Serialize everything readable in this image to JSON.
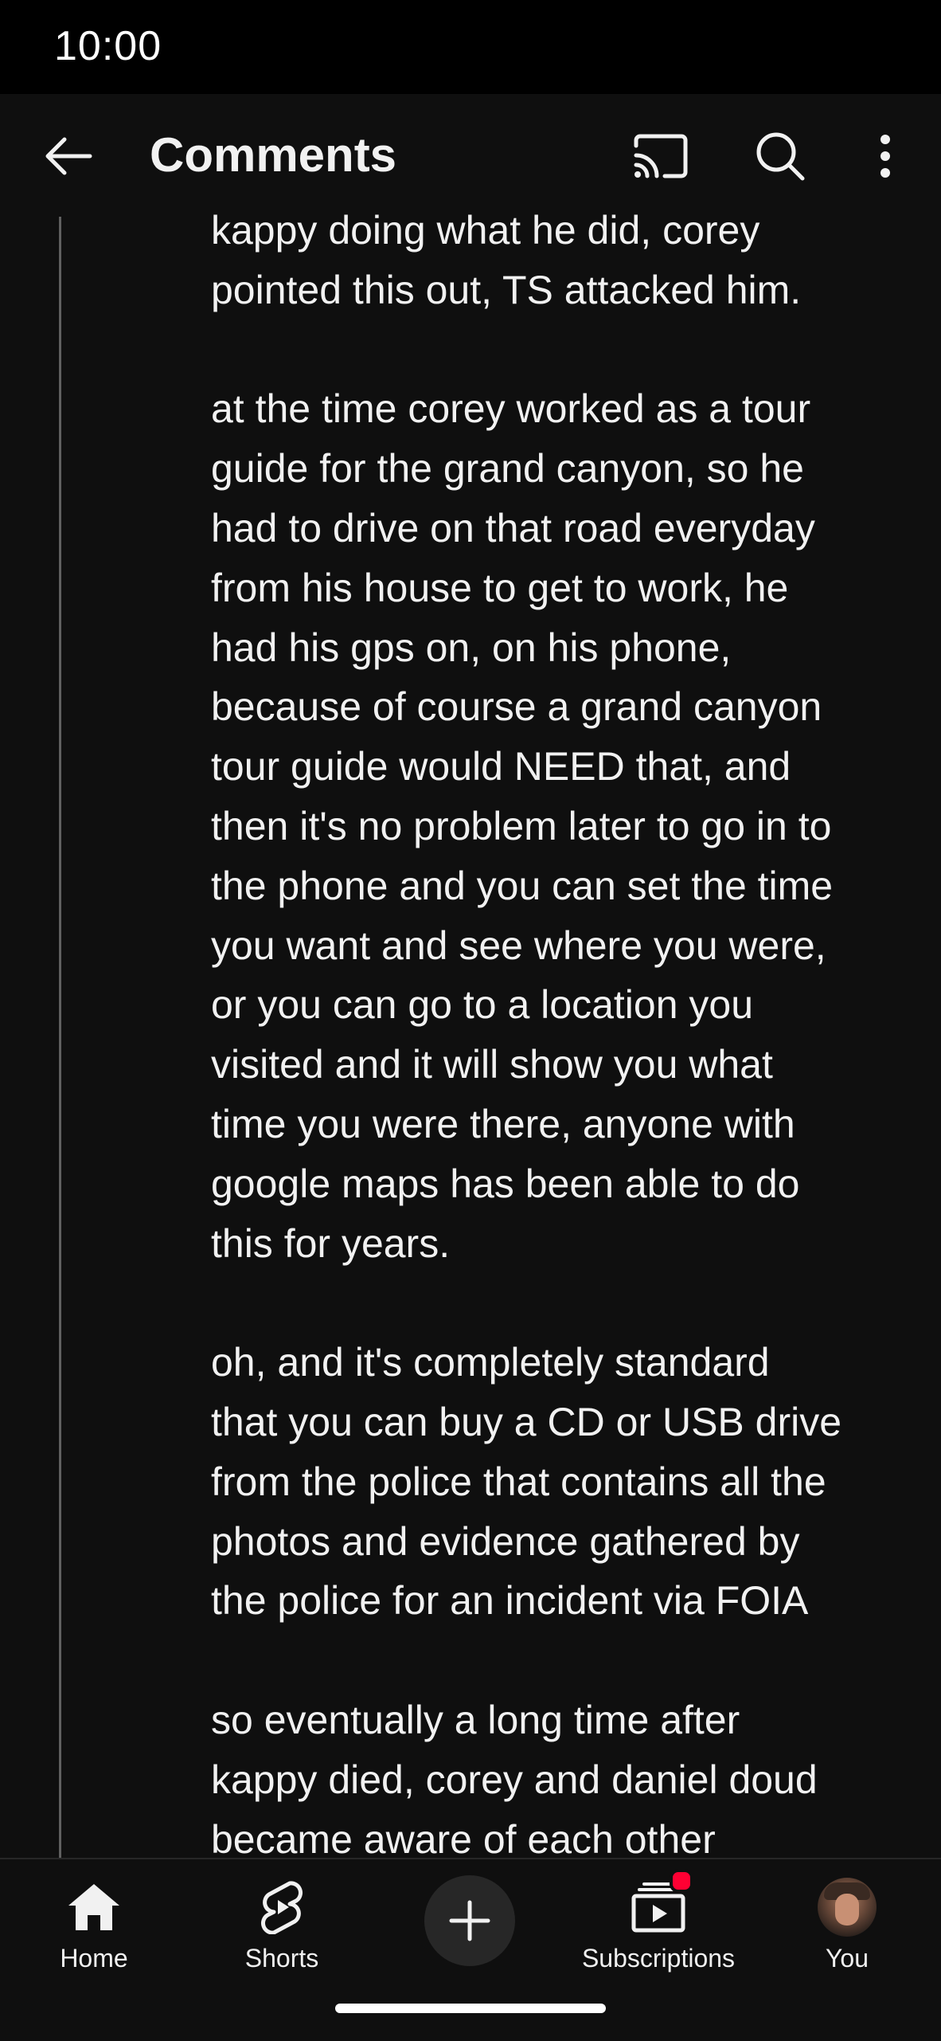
{
  "status_bar": {
    "time": "10:00"
  },
  "header": {
    "title": "Comments",
    "icons": [
      "back-arrow-icon",
      "cast-icon",
      "search-icon",
      "more-vert-icon"
    ]
  },
  "comment": {
    "lines": [
      "kappy doing what he did, corey",
      "pointed this out, TS attacked him.",
      "",
      "at the time corey worked as a tour",
      "guide for the grand canyon, so he",
      "had to drive on that road everyday",
      "from his house to get to work, he",
      "had his gps on, on his phone,",
      "because of course a grand canyon",
      "tour guide would NEED that, and",
      "then it's no problem later to go in to",
      "the phone and you can set the time",
      "you want and see where you were,",
      "or you can go to a location you",
      "visited and it will show you what",
      "time you were there, anyone with",
      "google maps has been able to do",
      "this for years.",
      "",
      "oh, and it's completely standard",
      "that you can buy a CD or USB drive",
      "from the police that contains all the",
      "photos and evidence gathered by",
      "the police for an incident via FOIA",
      "",
      "so eventually a long time after",
      "kappy died, corey and daniel doud",
      "became aware of each other"
    ]
  },
  "bottom_nav": {
    "items": [
      {
        "label": "Home",
        "icon": "home-icon"
      },
      {
        "label": "Shorts",
        "icon": "shorts-icon"
      },
      {
        "label": "",
        "icon": "create-plus-icon"
      },
      {
        "label": "Subscriptions",
        "icon": "subscriptions-icon"
      },
      {
        "label": "You",
        "icon": "avatar"
      }
    ]
  },
  "colors": {
    "background": "#0f0f0f",
    "text": "#f1f1f1",
    "badge": "#ff0033"
  }
}
